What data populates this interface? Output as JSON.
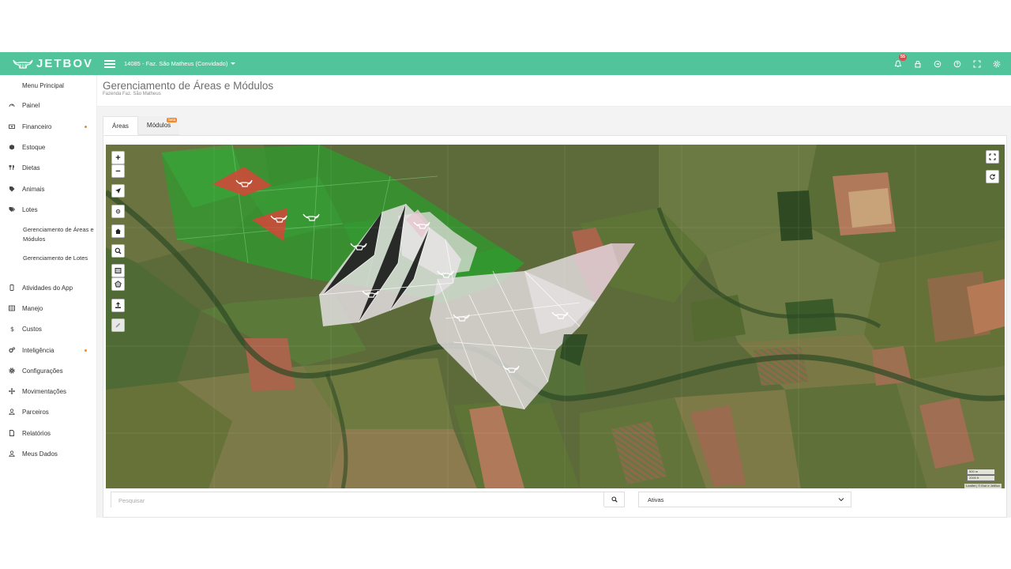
{
  "topbar": {
    "brand": "JETBOV",
    "farm_selector": "14085 - Faz. São Matheus (Convidado)",
    "notification_count": "55",
    "colors": {
      "bar": "#52c49c",
      "badge": "#e04a4a"
    },
    "icons": [
      "bell-icon",
      "lock-icon",
      "logout-icon",
      "help-icon",
      "fullscreen-icon",
      "gear-icon"
    ]
  },
  "sidebar": {
    "header": "Menu Principal",
    "items": [
      {
        "label": "Painel",
        "icon": "gauge-icon",
        "dot": false
      },
      {
        "label": "Financeiro",
        "icon": "money-icon",
        "dot": true
      },
      {
        "label": "Estoque",
        "icon": "box-icon",
        "dot": false
      },
      {
        "label": "Dietas",
        "icon": "cutlery-icon",
        "dot": false
      },
      {
        "label": "Animais",
        "icon": "tag-icon",
        "dot": false
      },
      {
        "label": "Lotes",
        "icon": "tags-icon",
        "dot": false
      }
    ],
    "sub_items": [
      "Gerenciamento de Áreas e Módulos",
      "Gerenciamento de Lotes"
    ],
    "items_after": [
      {
        "label": "Atividades do App",
        "icon": "mobile-icon",
        "dot": false
      },
      {
        "label": "Manejo",
        "icon": "clipboard-icon",
        "dot": false
      },
      {
        "label": "Custos",
        "icon": "dollar-icon",
        "dot": false
      },
      {
        "label": "Inteligência",
        "icon": "cogs-icon",
        "dot": true
      },
      {
        "label": "Configurações",
        "icon": "settings-icon",
        "dot": false
      },
      {
        "label": "Movimentações",
        "icon": "arrows-icon",
        "dot": false
      },
      {
        "label": "Parceiros",
        "icon": "user-icon",
        "dot": false
      },
      {
        "label": "Relatórios",
        "icon": "file-icon",
        "dot": false
      },
      {
        "label": "Meus Dados",
        "icon": "user-icon",
        "dot": false
      }
    ],
    "dot_color": "#f08a2b"
  },
  "page": {
    "title": "Gerenciamento de Áreas e Módulos",
    "subtitle": "Fazenda Faz. São Matheus"
  },
  "tabs": [
    {
      "label": "Áreas",
      "active": true
    },
    {
      "label": "Módulos",
      "active": false,
      "badge": "beta"
    }
  ],
  "map": {
    "zoom_in": "+",
    "zoom_out": "−",
    "scale_labels": [
      "500 m",
      "2000 ft"
    ],
    "attribution": "Leaflet | © Esri e JetBov",
    "area_colors": {
      "selected": "#e8e2e6",
      "green": "#2e9b2e",
      "red": "#d6453a"
    }
  },
  "filters": {
    "search_placeholder": "Pesquisar",
    "status_value": "Ativas"
  }
}
